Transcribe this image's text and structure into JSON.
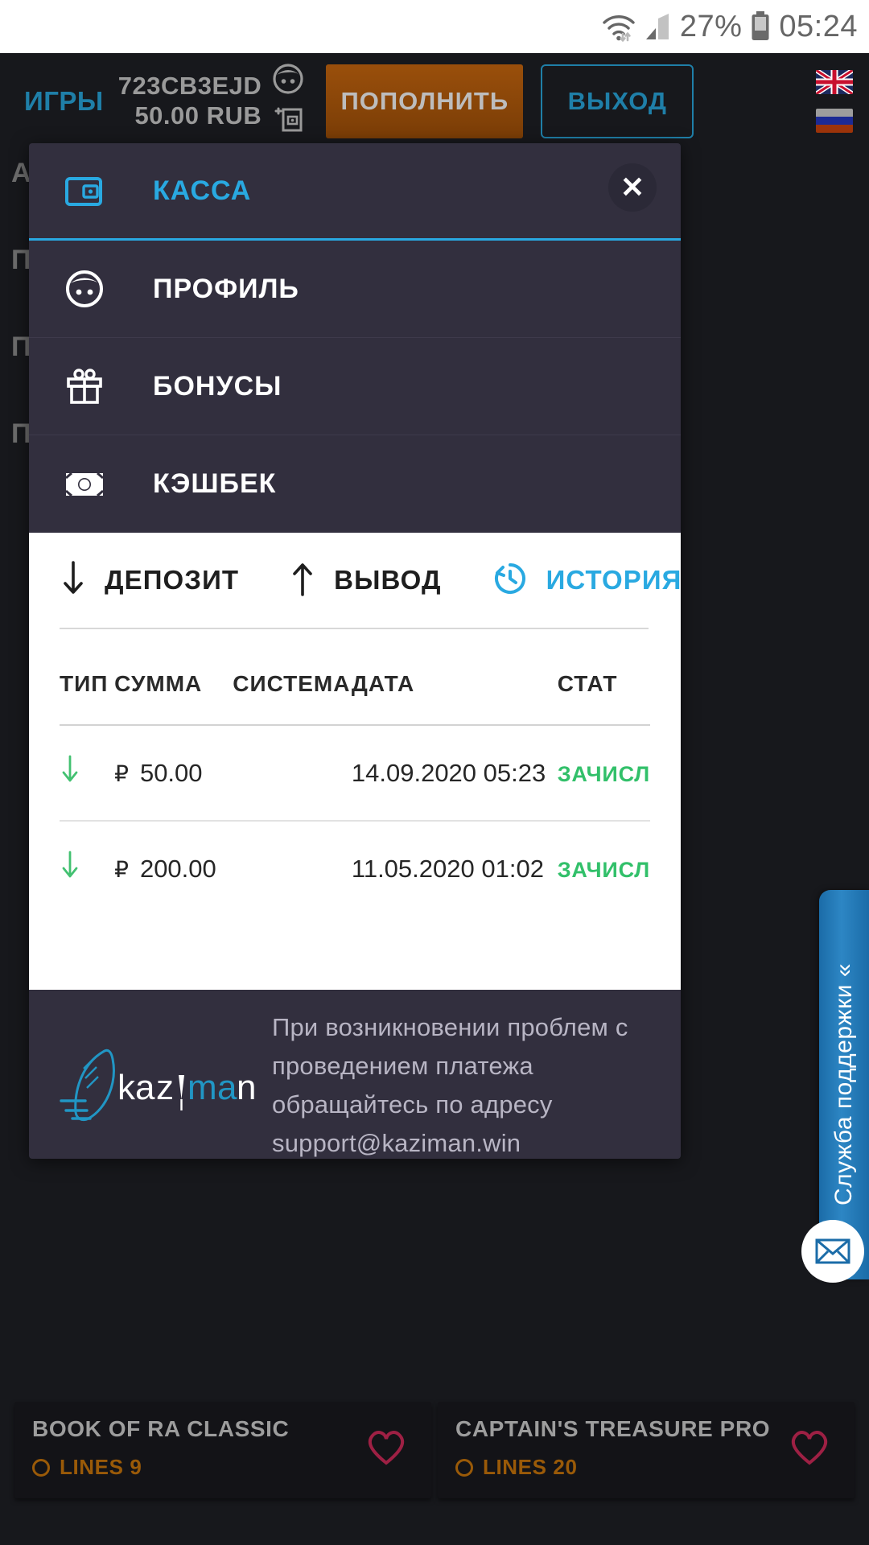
{
  "status_bar": {
    "battery_percent": "27%",
    "time": "05:24",
    "icons": [
      "wifi-icon",
      "signal-icon",
      "battery-icon"
    ]
  },
  "header": {
    "games_label": "ИГРЫ",
    "account_id": "723CB3EJD",
    "balance": "50.00 RUB",
    "deposit_button": "ПОПОЛНИТЬ",
    "exit_button": "ВЫХОД",
    "flags": [
      "flag-uk",
      "flag-ru"
    ]
  },
  "menu": {
    "close_label": "✕",
    "items": [
      {
        "label": "КАССА",
        "icon": "wallet-icon",
        "active": true
      },
      {
        "label": "ПРОФИЛЬ",
        "icon": "profile-icon",
        "active": false
      },
      {
        "label": "БОНУСЫ",
        "icon": "gift-icon",
        "active": false
      },
      {
        "label": "КЭШБЕК",
        "icon": "banknote-icon",
        "active": false
      }
    ]
  },
  "cashier": {
    "tabs": [
      {
        "label": "ДЕПОЗИТ",
        "icon": "arrow-down-icon",
        "active": false
      },
      {
        "label": "ВЫВОД",
        "icon": "arrow-up-icon",
        "active": false
      },
      {
        "label": "ИСТОРИЯ",
        "icon": "history-clock-icon",
        "active": true
      }
    ],
    "table": {
      "columns": [
        "ТИП",
        "СУММА",
        "СИСТЕМА",
        "ДАТА",
        "СТАТ"
      ],
      "rows": [
        {
          "type": "arrow-down-icon",
          "currency": "₽",
          "amount": "50.00",
          "system": "",
          "date": "14.09.2020 05:23",
          "status": "ЗАЧИСЛ"
        },
        {
          "type": "arrow-down-icon",
          "currency": "₽",
          "amount": "200.00",
          "system": "",
          "date": "11.05.2020 01:02",
          "status": "ЗАЧИСЛ"
        }
      ]
    }
  },
  "footer": {
    "logo_text": "kaziman",
    "message": "При возникновении проблем с проведением платежа обращайтесь по адресу support@kaziman.win"
  },
  "support": {
    "label": "Служба поддержки «",
    "mail_icon": "envelope-icon"
  },
  "game_cards": [
    {
      "title": "BOOK OF RA CLASSIC",
      "lines": "LINES 9",
      "favorite_icon": "heart-icon"
    },
    {
      "title": "CAPTAIN'S TREASURE PRO",
      "lines": "LINES 20",
      "favorite_icon": "heart-icon"
    }
  ],
  "background_text": [
    "A",
    "П",
    "П",
    "П"
  ],
  "colors": {
    "accent_blue": "#29a9e1",
    "link_blue": "#1f7fa8",
    "deposit_orange": "#9a4f0b",
    "status_green": "#32c06a",
    "panel_dark": "#322f3e",
    "app_dark": "#17181c",
    "support_blue": "#2d86c4"
  }
}
